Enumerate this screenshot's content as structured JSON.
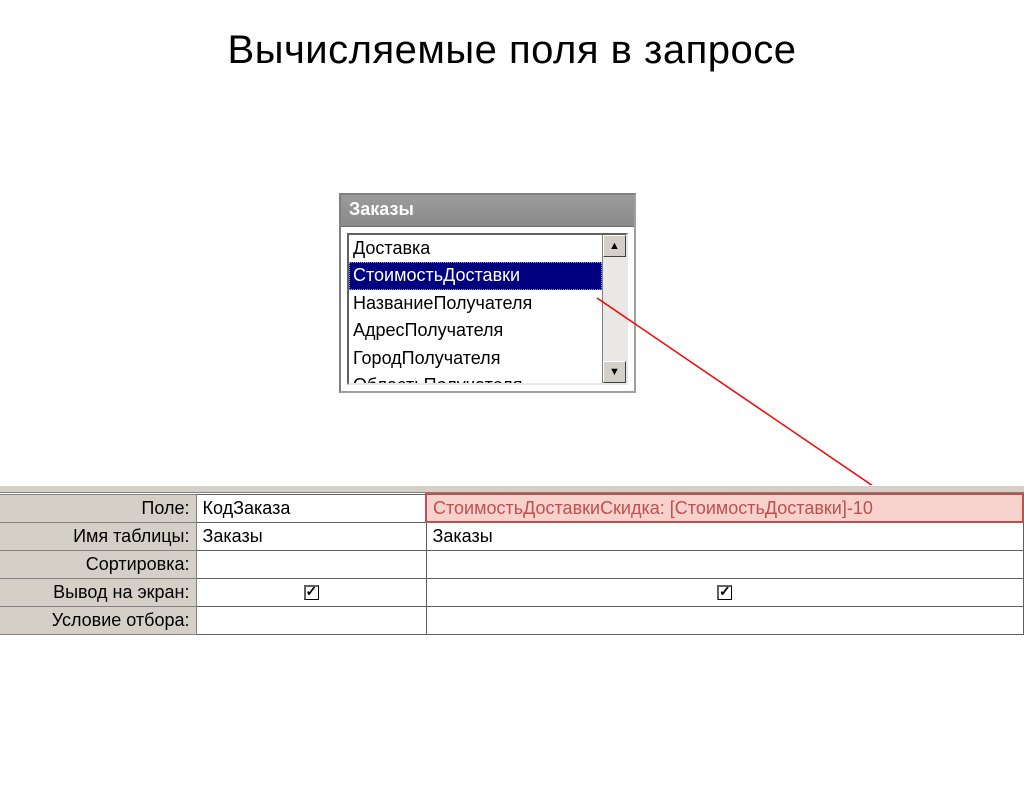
{
  "title": "Вычисляемые поля в запросе",
  "tableWindow": {
    "title": "Заказы",
    "items": [
      {
        "label": "Доставка",
        "selected": false
      },
      {
        "label": "СтоимостьДоставки",
        "selected": true
      },
      {
        "label": "НазваниеПолучателя",
        "selected": false
      },
      {
        "label": "АдресПолучателя",
        "selected": false
      },
      {
        "label": "ГородПолучателя",
        "selected": false
      },
      {
        "label": "ОбластьПолучателя",
        "selected": false
      }
    ]
  },
  "grid": {
    "rowLabels": {
      "field": "Поле:",
      "table": "Имя таблицы:",
      "sort": "Сортировка:",
      "show": "Вывод на экран:",
      "criteria": "Условие отбора:"
    },
    "columns": [
      {
        "field": "КодЗаказа",
        "table": "Заказы",
        "sort": "",
        "show": true,
        "criteria": "",
        "highlight": false
      },
      {
        "field": "СтоимостьДоставкиСкидка: [СтоимостьДоставки]-10",
        "table": "Заказы",
        "sort": "",
        "show": true,
        "criteria": "",
        "highlight": true
      }
    ]
  }
}
